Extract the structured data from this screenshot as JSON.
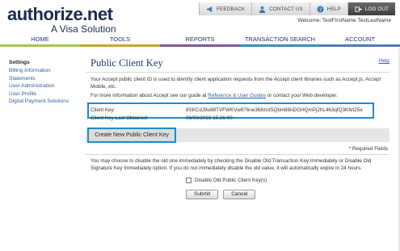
{
  "brand": {
    "logo_text": "authorize.net",
    "tagline": "A Visa Solution"
  },
  "utility": {
    "items": [
      {
        "label": "FEEDBACK",
        "icon": "megaphone-icon"
      },
      {
        "label": "CONTACT US",
        "icon": "person-icon"
      },
      {
        "label": "HELP",
        "icon": "help-icon"
      },
      {
        "label": "LOG OUT",
        "icon": "logout-icon"
      }
    ],
    "welcome": "Welcome: TestFirstName TestLastName"
  },
  "nav": {
    "tabs": [
      {
        "label": "HOME"
      },
      {
        "label": "TOOLS"
      },
      {
        "label": "REPORTS"
      },
      {
        "label": "TRANSACTION SEARCH"
      },
      {
        "label": "ACCOUNT"
      }
    ]
  },
  "sidebar": {
    "title": "Settings",
    "items": [
      {
        "label": "Billing Information"
      },
      {
        "label": "Statements"
      },
      {
        "label": "User Administration"
      },
      {
        "label": "User Profile"
      },
      {
        "label": "Digital Payment Solutions"
      }
    ]
  },
  "main": {
    "title": "Public Client Key",
    "help_label": "Help",
    "description": "Your Accept public client ID is used to identify client application requests from the Accept client libraries such as Accept.js, Accept Mobile, etc.",
    "info_prefix": "For more information about Accept see our guide at ",
    "info_link": "Reference & User Guides",
    "info_suffix": " or contact your Web developer.",
    "client_key_label": "Client Key:",
    "client_key_value": "8SKCdJ9u98TVFWKVw876ne368zutSQbm89nDGHQmPj2hL463qfQ3Kfet25e",
    "last_obtained_label": "Client Key Last Obtained:",
    "last_obtained_value": "08/03/2023 15:26:00",
    "generate_button": "Create New Public Client Key",
    "required_note": "* Required Fields",
    "disable_info": "You may choose to disable the old one immediately by checking the Disable Old Transaction Key Immediately or Disable Old Signature Key Immediately option. If you do not immediately disable the old value, it will automatically expire in 24 hours.",
    "disable_checkbox_label": "Disable Old Public Client Key(s)",
    "submit_label": "Submit",
    "cancel_label": "Cancel"
  },
  "colors": {
    "accent_highlight": "#1a8ccf",
    "link": "#2f5f9a",
    "brand_navy": "#1c2a4a"
  }
}
